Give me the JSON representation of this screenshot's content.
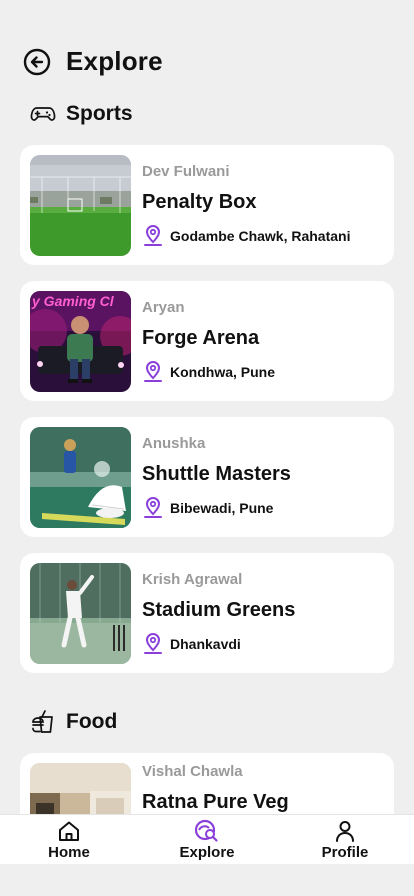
{
  "header": {
    "title": "Explore",
    "back_icon": "back-arrow-icon"
  },
  "sections": [
    {
      "title": "Sports",
      "icon": "gamepad-icon"
    },
    {
      "title": "Food",
      "icon": "fast-food-icon"
    }
  ],
  "sports": [
    {
      "owner": "Dev Fulwani",
      "venue": "Penalty Box",
      "location": "Godambe Chawk, Rahatani",
      "image": "turf-field-photo"
    },
    {
      "owner": "Aryan",
      "venue": "Forge Arena",
      "location": "Kondhwa, Pune",
      "image": "gaming-club-photo",
      "image_text": "y Gaming Cl"
    },
    {
      "owner": "Anushka",
      "venue": "Shuttle Masters",
      "location": "Bibewadi, Pune",
      "image": "badminton-court-photo"
    },
    {
      "owner": "Krish Agrawal",
      "venue": "Stadium Greens",
      "location": "Dhankavdi",
      "image": "cricket-net-photo"
    }
  ],
  "food": [
    {
      "owner": "Vishal Chawla",
      "venue": "Ratna Pure Veg",
      "image": "restaurant-photo"
    }
  ],
  "nav": [
    {
      "label": "Home",
      "icon": "home-icon",
      "active": false
    },
    {
      "label": "Explore",
      "icon": "explore-search-icon",
      "active": true
    },
    {
      "label": "Profile",
      "icon": "profile-icon",
      "active": false
    }
  ],
  "colors": {
    "accent": "#8b3fd9",
    "background": "#efefef",
    "card": "#ffffff",
    "muted": "#9a9a9a"
  }
}
